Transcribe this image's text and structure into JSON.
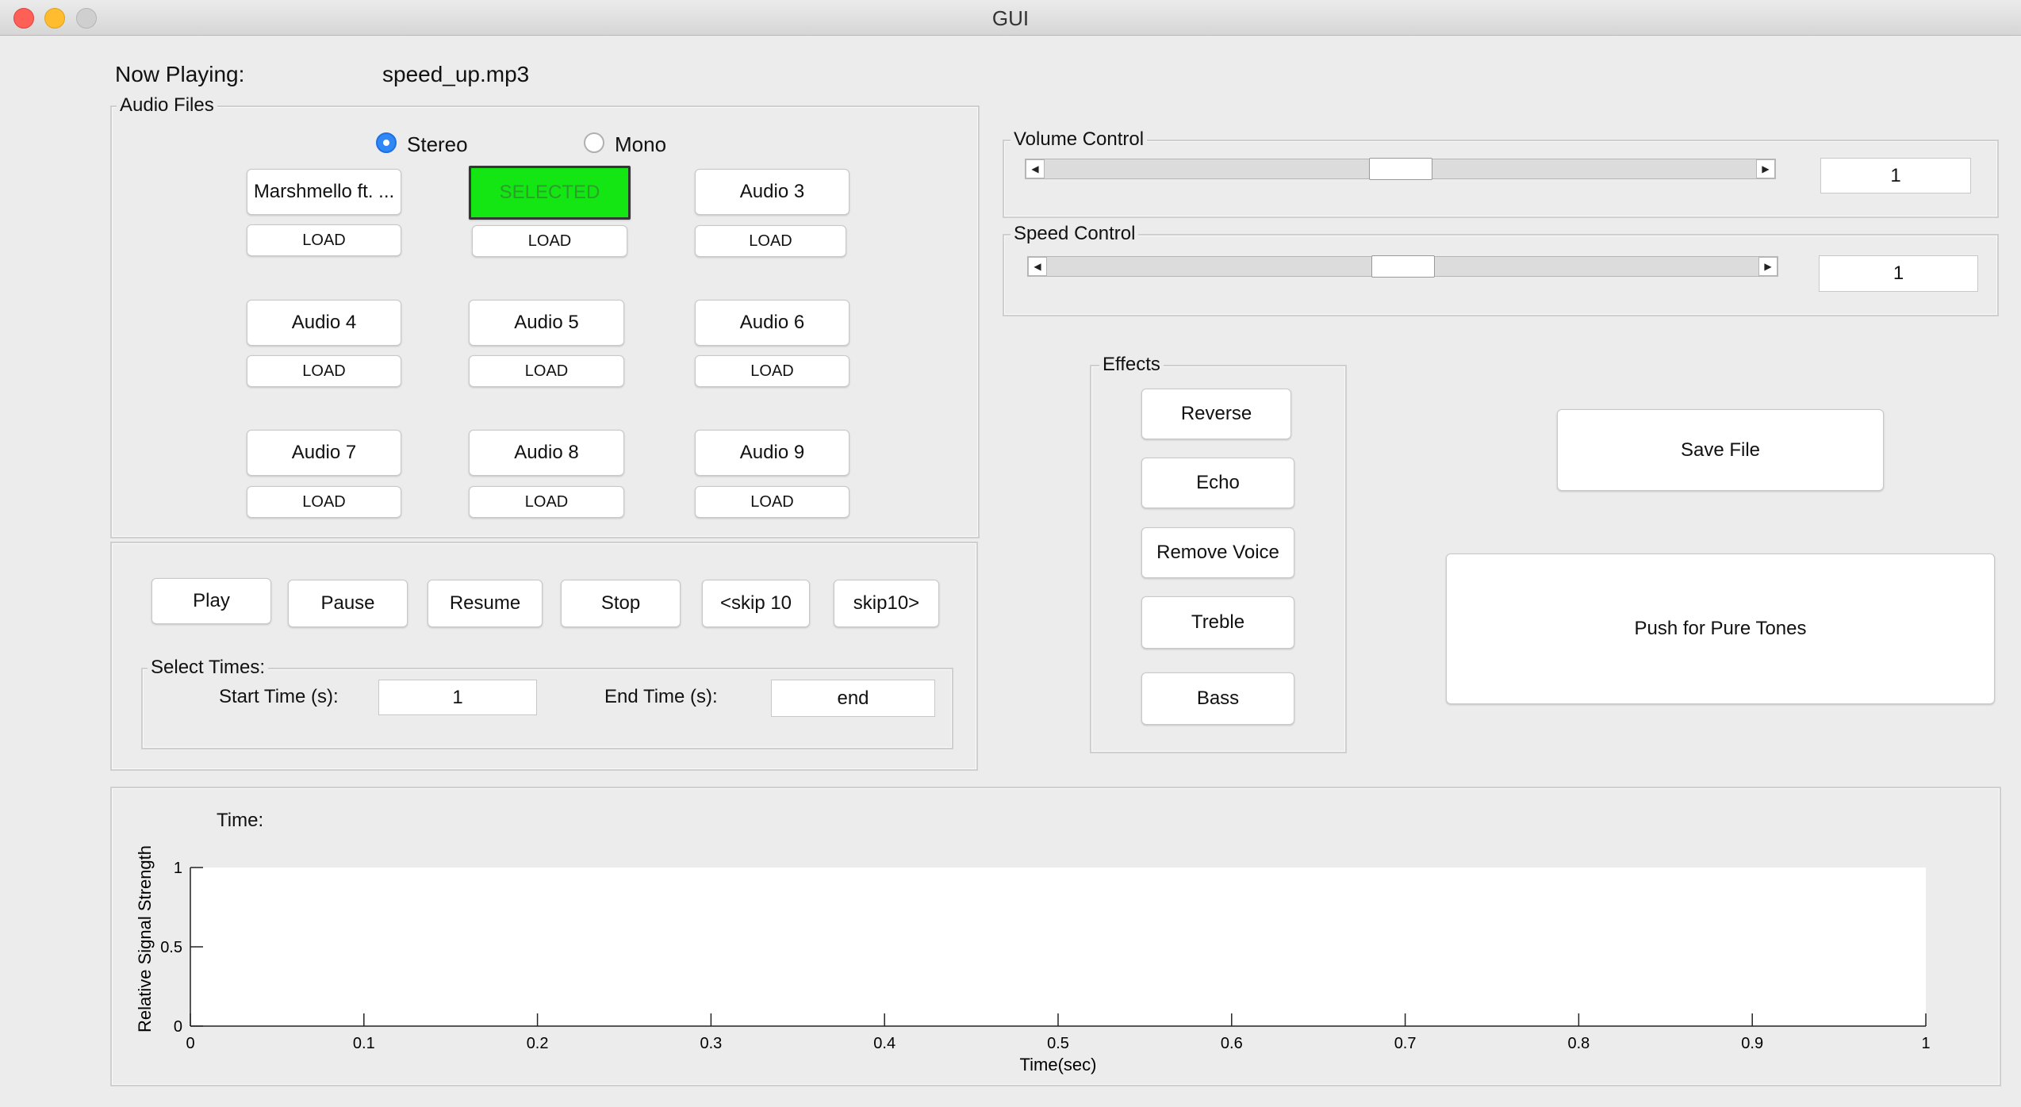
{
  "window": {
    "title": "GUI"
  },
  "now_playing": {
    "label": "Now Playing:",
    "value": "speed_up.mp3"
  },
  "audio_files": {
    "title": "Audio Files",
    "stereo_label": "Stereo",
    "mono_label": "Mono",
    "channel_mode": "Stereo",
    "load_label": "LOAD",
    "tracks": [
      "Marshmello ft. ...",
      "SELECTED",
      "Audio 3",
      "Audio 4",
      "Audio 5",
      "Audio 6",
      "Audio 7",
      "Audio 8",
      "Audio 9"
    ],
    "selected_index": 1
  },
  "playback": {
    "play": "Play",
    "pause": "Pause",
    "resume": "Resume",
    "stop": "Stop",
    "skip_back": "<skip 10",
    "skip_fwd": "skip10>"
  },
  "select_times": {
    "title": "Select Times:",
    "start_label": "Start Time (s):",
    "start_value": "1",
    "end_label": "End Time (s):",
    "end_value": "end"
  },
  "volume": {
    "title": "Volume Control",
    "value": "1",
    "slider_fraction": 0.5
  },
  "speed": {
    "title": "Speed Control",
    "value": "1",
    "slider_fraction": 0.5
  },
  "effects": {
    "title": "Effects",
    "reverse": "Reverse",
    "echo": "Echo",
    "remove_voice": "Remove Voice",
    "treble": "Treble",
    "bass": "Bass"
  },
  "actions": {
    "save_file": "Save File",
    "pure_tones": "Push for Pure Tones"
  },
  "plot": {
    "time_label": "Time:",
    "chart_data": {
      "type": "line",
      "title": "",
      "xlabel": "Time(sec)",
      "ylabel": "Relative Signal Strength",
      "xlim": [
        0,
        1
      ],
      "ylim": [
        0,
        1
      ],
      "xticks": [
        "0",
        "0.1",
        "0.2",
        "0.3",
        "0.4",
        "0.5",
        "0.6",
        "0.7",
        "0.8",
        "0.9",
        "1"
      ],
      "yticks": [
        "0",
        "0.5",
        "1"
      ],
      "series": [],
      "grid": false
    }
  },
  "colors": {
    "selected_green": "#14e614",
    "radio_blue": "#2f88f5"
  }
}
